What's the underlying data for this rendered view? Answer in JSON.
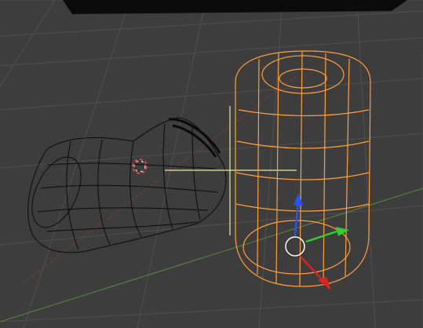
{
  "viewport": {
    "background": "#3d3d3d",
    "grid_color": "#505050",
    "axis_x_color": "#8a3a3a",
    "axis_y_color": "#5a8a3a",
    "selected_wire_color": "#ff9f3a",
    "unselected_wire_color": "#0a0a0a",
    "cursor_color": "#e04040",
    "guide_color": "#e8e8a0"
  },
  "objects": [
    {
      "name": "can-mesh",
      "state": "selected"
    },
    {
      "name": "boot-mesh",
      "state": "unselected"
    }
  ],
  "gizmo": {
    "z_color": "#2255ff",
    "y_color": "#33cc33",
    "x_color": "#dd2222",
    "center_color": "#ffffff"
  }
}
